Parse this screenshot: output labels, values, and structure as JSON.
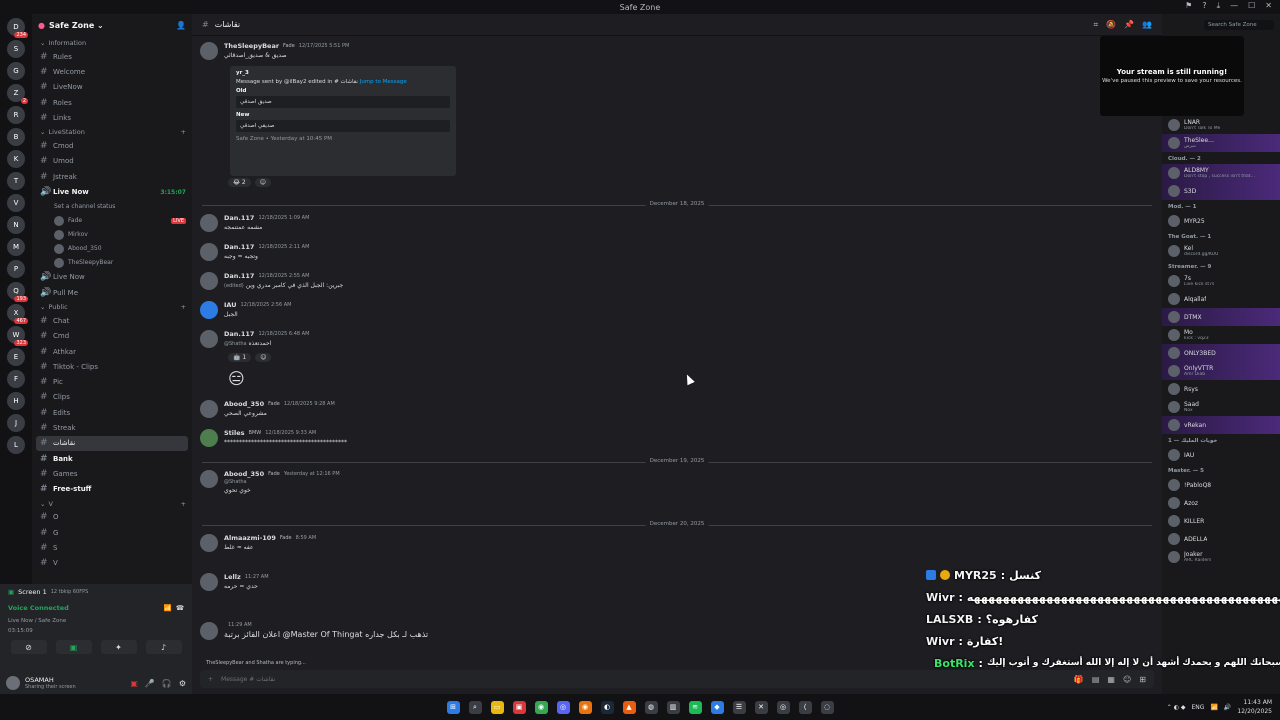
{
  "window": {
    "title": "Safe Zone",
    "controls": [
      "—",
      "☐",
      "✕"
    ]
  },
  "servers": [
    {
      "label": "D",
      "badge": "234"
    },
    {
      "label": "S",
      "badge": ""
    },
    {
      "label": "G",
      "badge": ""
    },
    {
      "label": "Z",
      "badge": "2"
    },
    {
      "label": "R",
      "badge": ""
    },
    {
      "label": "B",
      "badge": ""
    },
    {
      "label": "K",
      "badge": ""
    },
    {
      "label": "T",
      "badge": ""
    },
    {
      "label": "V",
      "badge": ""
    },
    {
      "label": "N",
      "badge": ""
    },
    {
      "label": "M",
      "badge": ""
    },
    {
      "label": "P",
      "badge": ""
    },
    {
      "label": "Q",
      "badge": "193"
    },
    {
      "label": "X",
      "badge": "467"
    },
    {
      "label": "W",
      "badge": "323"
    },
    {
      "label": "E",
      "badge": ""
    },
    {
      "label": "F",
      "badge": ""
    },
    {
      "label": "H",
      "badge": ""
    },
    {
      "label": "J",
      "badge": ""
    },
    {
      "label": "L",
      "badge": ""
    }
  ],
  "guild": {
    "name": "Safe Zone ⌄"
  },
  "channels": {
    "cat_info": "Information",
    "info": [
      "Rules",
      "Welcome",
      "LiveNow",
      "Roles",
      "Links"
    ],
    "cat_live": "LiveStation",
    "live": [
      "Cmod",
      "Umod",
      "Jstreak"
    ],
    "live_now": {
      "name": "Live Now",
      "time": "3:15:07",
      "status": "Set a channel status",
      "live_tag": "LIVE"
    },
    "voice_users": [
      "Fade",
      "Mirkov",
      "Abood_350",
      "TheSleepyBear"
    ],
    "after_voice": [
      "Live Now",
      "Pull Me"
    ],
    "cat_public": "Public",
    "public": [
      "Chat",
      "Cmd",
      "Athkar",
      "Tiktok - Clips",
      "Pic",
      "Clips",
      "Edits",
      "Streak",
      "نقاشات",
      "Bank",
      "Games",
      "Free-stuff"
    ],
    "cat_v": "V",
    "v": [
      "O",
      "G",
      "S",
      "V"
    ]
  },
  "userpanel": {
    "screen": "Screen 1",
    "screen_sub": "12 tbkip 60FPS",
    "voice_connected": "Voice Connected",
    "voice_path": "Live Now / Safe Zone",
    "voice_time": "03:15:09",
    "name": "OSAMAH",
    "sub": "Sharing their screen"
  },
  "chat": {
    "channel": "نقاشات",
    "messages": [
      {
        "user": "TheSleepyBear",
        "tag": "Fade",
        "time": "12/17/2025 5:51 PM",
        "text": "صديق & صديق_اصدقائي",
        "reply": ""
      },
      {
        "user": "Dan.117",
        "tag": "",
        "time": "12/18/2025 1:09 AM",
        "text": "مشمه عمتنمجه",
        "reply": ""
      },
      {
        "user": "Dan.117",
        "tag": "",
        "time": "12/18/2025 2:11 AM",
        "text": "وتجبه ≈ وجبه",
        "reply": ""
      },
      {
        "user": "Dan.117",
        "tag": "",
        "time": "12/18/2025 2:55 AM",
        "text": "جبرين: الجبل الذي في كامبر مدري وين",
        "reply": "(edited)"
      },
      {
        "user": "IAU",
        "tag": "",
        "time": "12/18/2025 2:56 AM",
        "text": "الجبل",
        "reply": ""
      },
      {
        "user": "Dan.117",
        "tag": "",
        "time": "12/18/2025 6:48 AM",
        "text": "احمدتعذه",
        "reply": "@Shatha"
      },
      {
        "user": "Abood_350",
        "tag": "Fade",
        "time": "12/18/2025 9:28 AM",
        "text": "مشروعي الصحي",
        "reply": ""
      },
      {
        "user": "Stiles",
        "tag": "BMW",
        "time": "12/18/2025 9:33 AM",
        "text": "*****************************************",
        "reply": ""
      },
      {
        "user": "Abood_350",
        "tag": "Fade",
        "time": "Yesterday at 12:16 PM",
        "text": "خوي تحوي",
        "reply": "@Shatha"
      },
      {
        "user": "Almaazmi-109",
        "tag": "Fade",
        "time": "8:59 AM",
        "text": "عفه ≈ غلط",
        "reply": ""
      },
      {
        "user": "Lellz",
        "tag": "",
        "time": "11:27 AM",
        "text": "حدي = حرمه",
        "reply": ""
      },
      {
        "user": "",
        "tag": "",
        "time": "11:29 AM",
        "text": "اعلان القائز برتبة @Master Of Thingat تذهب لـ بكل جداره",
        "reply": ""
      }
    ],
    "dividers": [
      "December 18, 2025",
      "December 19, 2025",
      "December 20, 2025"
    ],
    "embed": {
      "user": "yr_3",
      "line": "Message sent by @ilBay2 edited in # نقاشات",
      "jump": "Jump to Message",
      "old_label": "Old",
      "old": "صديق اصدقي",
      "new_label": "New",
      "new": "صديقي اصدقي",
      "footer": "Safe Zone • Yesterday at 10:45 PM"
    },
    "reaction": "2",
    "reaction2": "1",
    "typing": "TheSleepyBear and Shatha are typing...",
    "placeholder": "Message # نقاشات"
  },
  "members": {
    "search": "Search Safe Zone",
    "stream_title": "Your stream is still running!",
    "stream_sub": "We've paused this preview to save your resources.",
    "groups": [
      {
        "cat": "",
        "list": [
          {
            "n": "LNAR",
            "s": "Don't Talk To Me"
          },
          {
            "n": "TheSlee…",
            "s": "سرس"
          }
        ]
      },
      {
        "cat": "Cloud. — 2",
        "list": [
          {
            "n": "ALD8MY",
            "s": "Don't stop , success isn't that…"
          },
          {
            "n": "S3D",
            "s": ""
          }
        ]
      },
      {
        "cat": "Mod. — 1",
        "list": [
          {
            "n": "MYR25",
            "s": ""
          }
        ]
      },
      {
        "cat": "The Goat. — 1",
        "list": [
          {
            "n": "Kel",
            "s": "discord.gg/KUU"
          }
        ]
      },
      {
        "cat": "Streamer. — 9",
        "list": [
          {
            "n": "7s",
            "s": "Live kick st7s"
          },
          {
            "n": "Alqallaf",
            "s": ""
          },
          {
            "n": "DTMX",
            "s": ""
          },
          {
            "n": "Mo",
            "s": "kick : vq23"
          },
          {
            "n": "ONLY3BED",
            "s": ""
          },
          {
            "n": "OnlyVTTR",
            "s": "Amr Diab"
          },
          {
            "n": "Rsys",
            "s": ""
          },
          {
            "n": "Saad",
            "s": "Nox"
          },
          {
            "n": "vRekan",
            "s": ""
          }
        ]
      },
      {
        "cat": "خويات المليك — 1",
        "list": [
          {
            "n": "IAU",
            "s": ""
          }
        ]
      },
      {
        "cat": "Master. — 5",
        "list": [
          {
            "n": "!PabloQ8",
            "s": ""
          },
          {
            "n": "Azoz",
            "s": ""
          },
          {
            "n": "KILLER",
            "s": ""
          },
          {
            "n": "ADELLA",
            "s": ""
          },
          {
            "n": "Joaker",
            "s": "ARC Raiders"
          }
        ]
      }
    ]
  },
  "overlay": [
    {
      "name": "MYR25",
      "sep": ":",
      "text": "كنسل",
      "green": false
    },
    {
      "name": "Wivr",
      "sep": ":",
      "text": "ههههههههههههههههههههههههههههههههههههههههههههه",
      "green": false
    },
    {
      "name": "LALSXB",
      "sep": ":",
      "text": "كفارهوه؟",
      "green": false
    },
    {
      "name": "Wivr",
      "sep": ":",
      "text": "كفارة!",
      "green": false
    },
    {
      "name": "BotRix",
      "sep": ":",
      "text": "سبحانك اللهم و بحمدك أشهد أن لا إله إلا الله أستغفرك و أتوب إليك",
      "green": true
    }
  ],
  "taskbar": {
    "time": "11:43 AM",
    "date": "12/20/2025",
    "lang": "ENG"
  },
  "colors": {
    "accent": "#5865f2",
    "live": "#da373c",
    "online": "#23a55a"
  }
}
